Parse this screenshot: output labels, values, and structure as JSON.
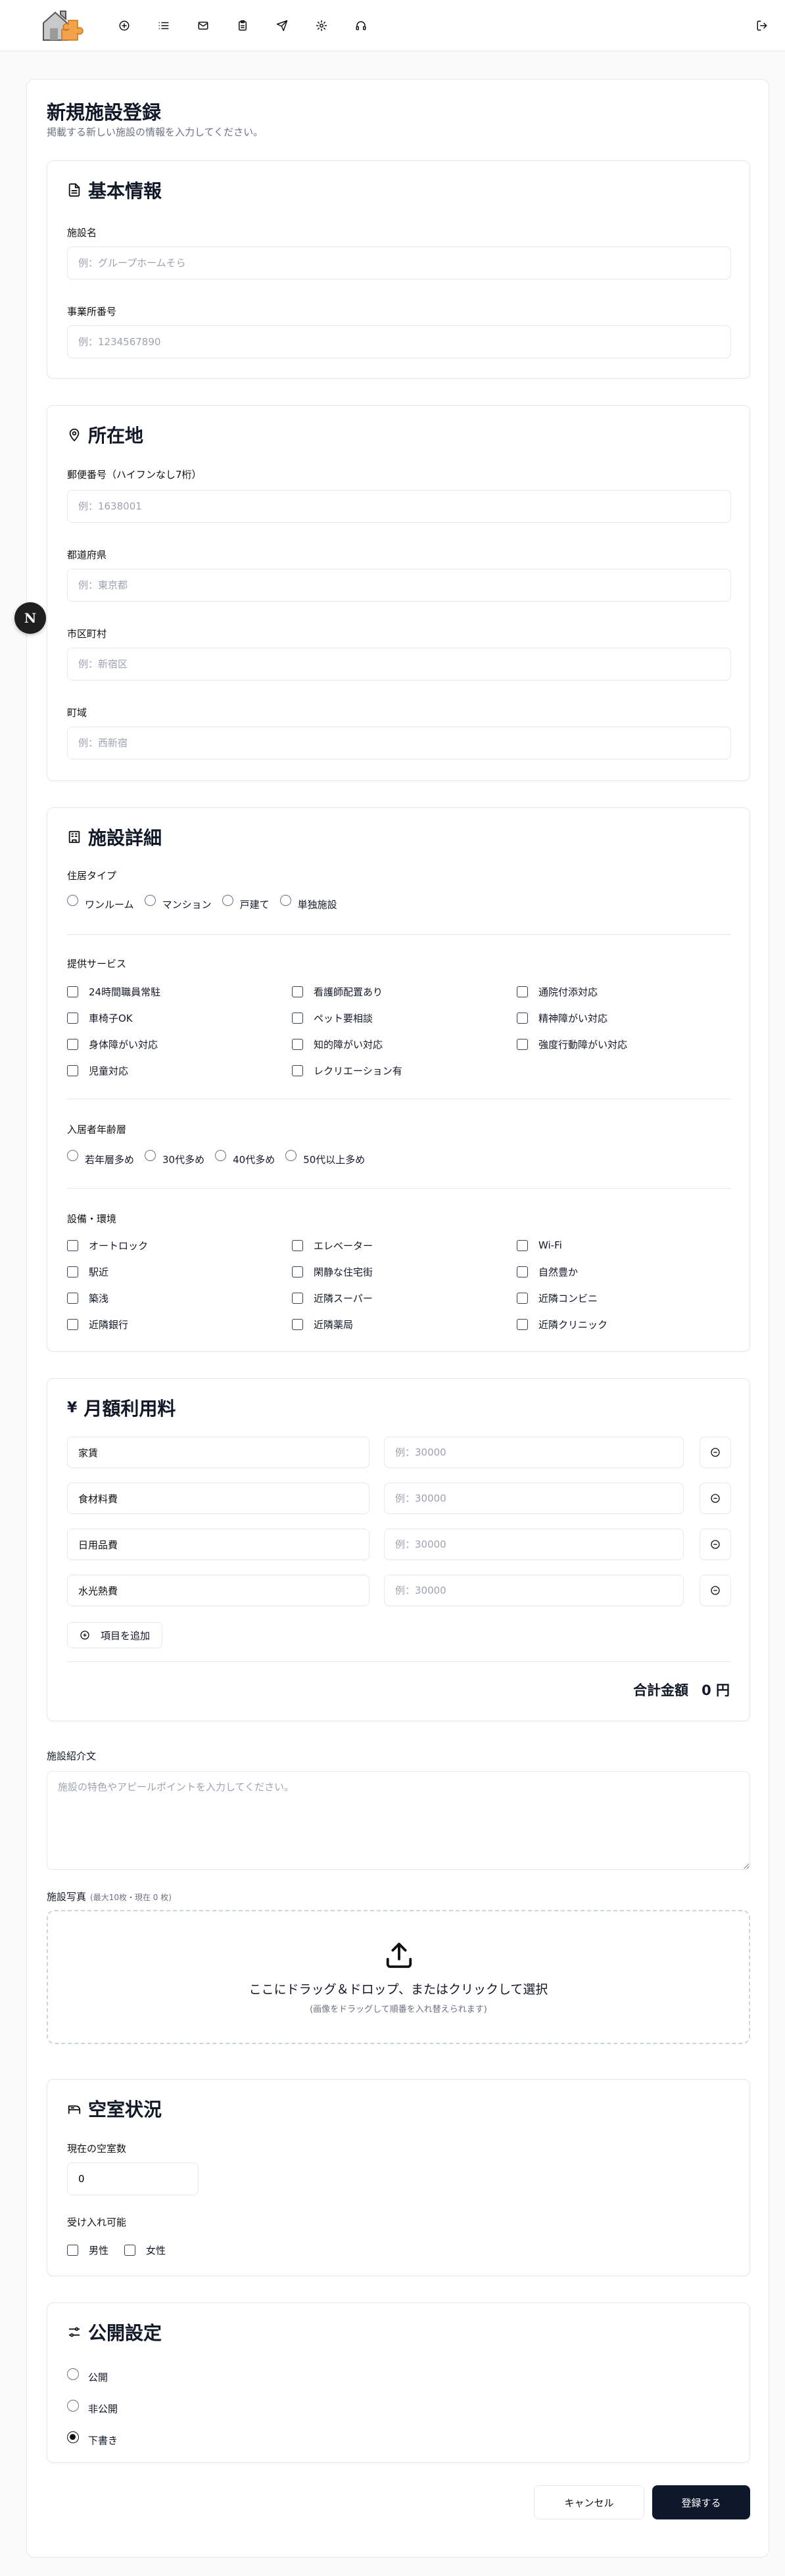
{
  "header": {
    "nav": [
      {
        "icon": "plus-circle-icon"
      },
      {
        "icon": "list-icon"
      },
      {
        "icon": "mail-icon"
      },
      {
        "icon": "clipboard-icon"
      },
      {
        "icon": "send-icon"
      },
      {
        "icon": "gear-icon"
      },
      {
        "icon": "headset-icon"
      }
    ],
    "logout_icon": "logout-icon"
  },
  "page": {
    "title": "新規施設登録",
    "description": "掲載する新しい施設の情報を入力してください。"
  },
  "basic": {
    "title": "基本情報",
    "name_label": "施設名",
    "name_placeholder": "例：グループホームそら",
    "office_label": "事業所番号",
    "office_placeholder": "例：1234567890"
  },
  "location": {
    "title": "所在地",
    "zip_label": "郵便番号（ハイフンなし7桁）",
    "zip_placeholder": "例：1638001",
    "pref_label": "都道府県",
    "pref_placeholder": "例：東京都",
    "city_label": "市区町村",
    "city_placeholder": "例：新宿区",
    "town_label": "町域",
    "town_placeholder": "例：西新宿"
  },
  "details": {
    "title": "施設詳細",
    "housing_label": "住居タイプ",
    "housing_options": [
      "ワンルーム",
      "マンション",
      "戸建て",
      "単独施設"
    ],
    "services_label": "提供サービス",
    "services": [
      "24時間職員常駐",
      "看護師配置あり",
      "通院付添対応",
      "車椅子OK",
      "ペット要相談",
      "精神障がい対応",
      "身体障がい対応",
      "知的障がい対応",
      "強度行動障がい対応",
      "児童対応",
      "レクリエーション有"
    ],
    "age_label": "入居者年齢層",
    "age_options": [
      "若年層多め",
      "30代多め",
      "40代多め",
      "50代以上多め"
    ],
    "facilities_label": "設備・環境",
    "facilities": [
      "オートロック",
      "エレベーター",
      "Wi-Fi",
      "駅近",
      "閑静な住宅街",
      "自然豊か",
      "築浅",
      "近隣スーパー",
      "近隣コンビニ",
      "近隣銀行",
      "近隣薬局",
      "近隣クリニック"
    ]
  },
  "fees": {
    "title": "月額利用料",
    "items": [
      {
        "name": "家賃",
        "placeholder": "例：30000"
      },
      {
        "name": "食材料費",
        "placeholder": "例：30000"
      },
      {
        "name": "日用品費",
        "placeholder": "例：30000"
      },
      {
        "name": "水光熱費",
        "placeholder": "例：30000"
      }
    ],
    "add_label": "項目を追加",
    "total_label": "合計金額",
    "total_value": "0 円"
  },
  "intro": {
    "label": "施設紹介文",
    "placeholder": "施設の特色やアピールポイントを入力してください。"
  },
  "photos": {
    "label": "施設写真",
    "note": "(最大10枚・現在 0 枚)",
    "drop_text": "ここにドラッグ＆ドロップ、またはクリックして選択",
    "drop_sub": "(画像をドラッグして順番を入れ替えられます)"
  },
  "vacancy": {
    "title": "空室状況",
    "count_label": "現在の空室数",
    "count_value": "0",
    "accept_label": "受け入れ可能",
    "genders": [
      "男性",
      "女性"
    ]
  },
  "publish": {
    "title": "公開設定",
    "options": [
      "公開",
      "非公開",
      "下書き"
    ],
    "selected": "下書き"
  },
  "actions": {
    "cancel": "キャンセル",
    "submit": "登録する"
  },
  "fab_letter": "N"
}
